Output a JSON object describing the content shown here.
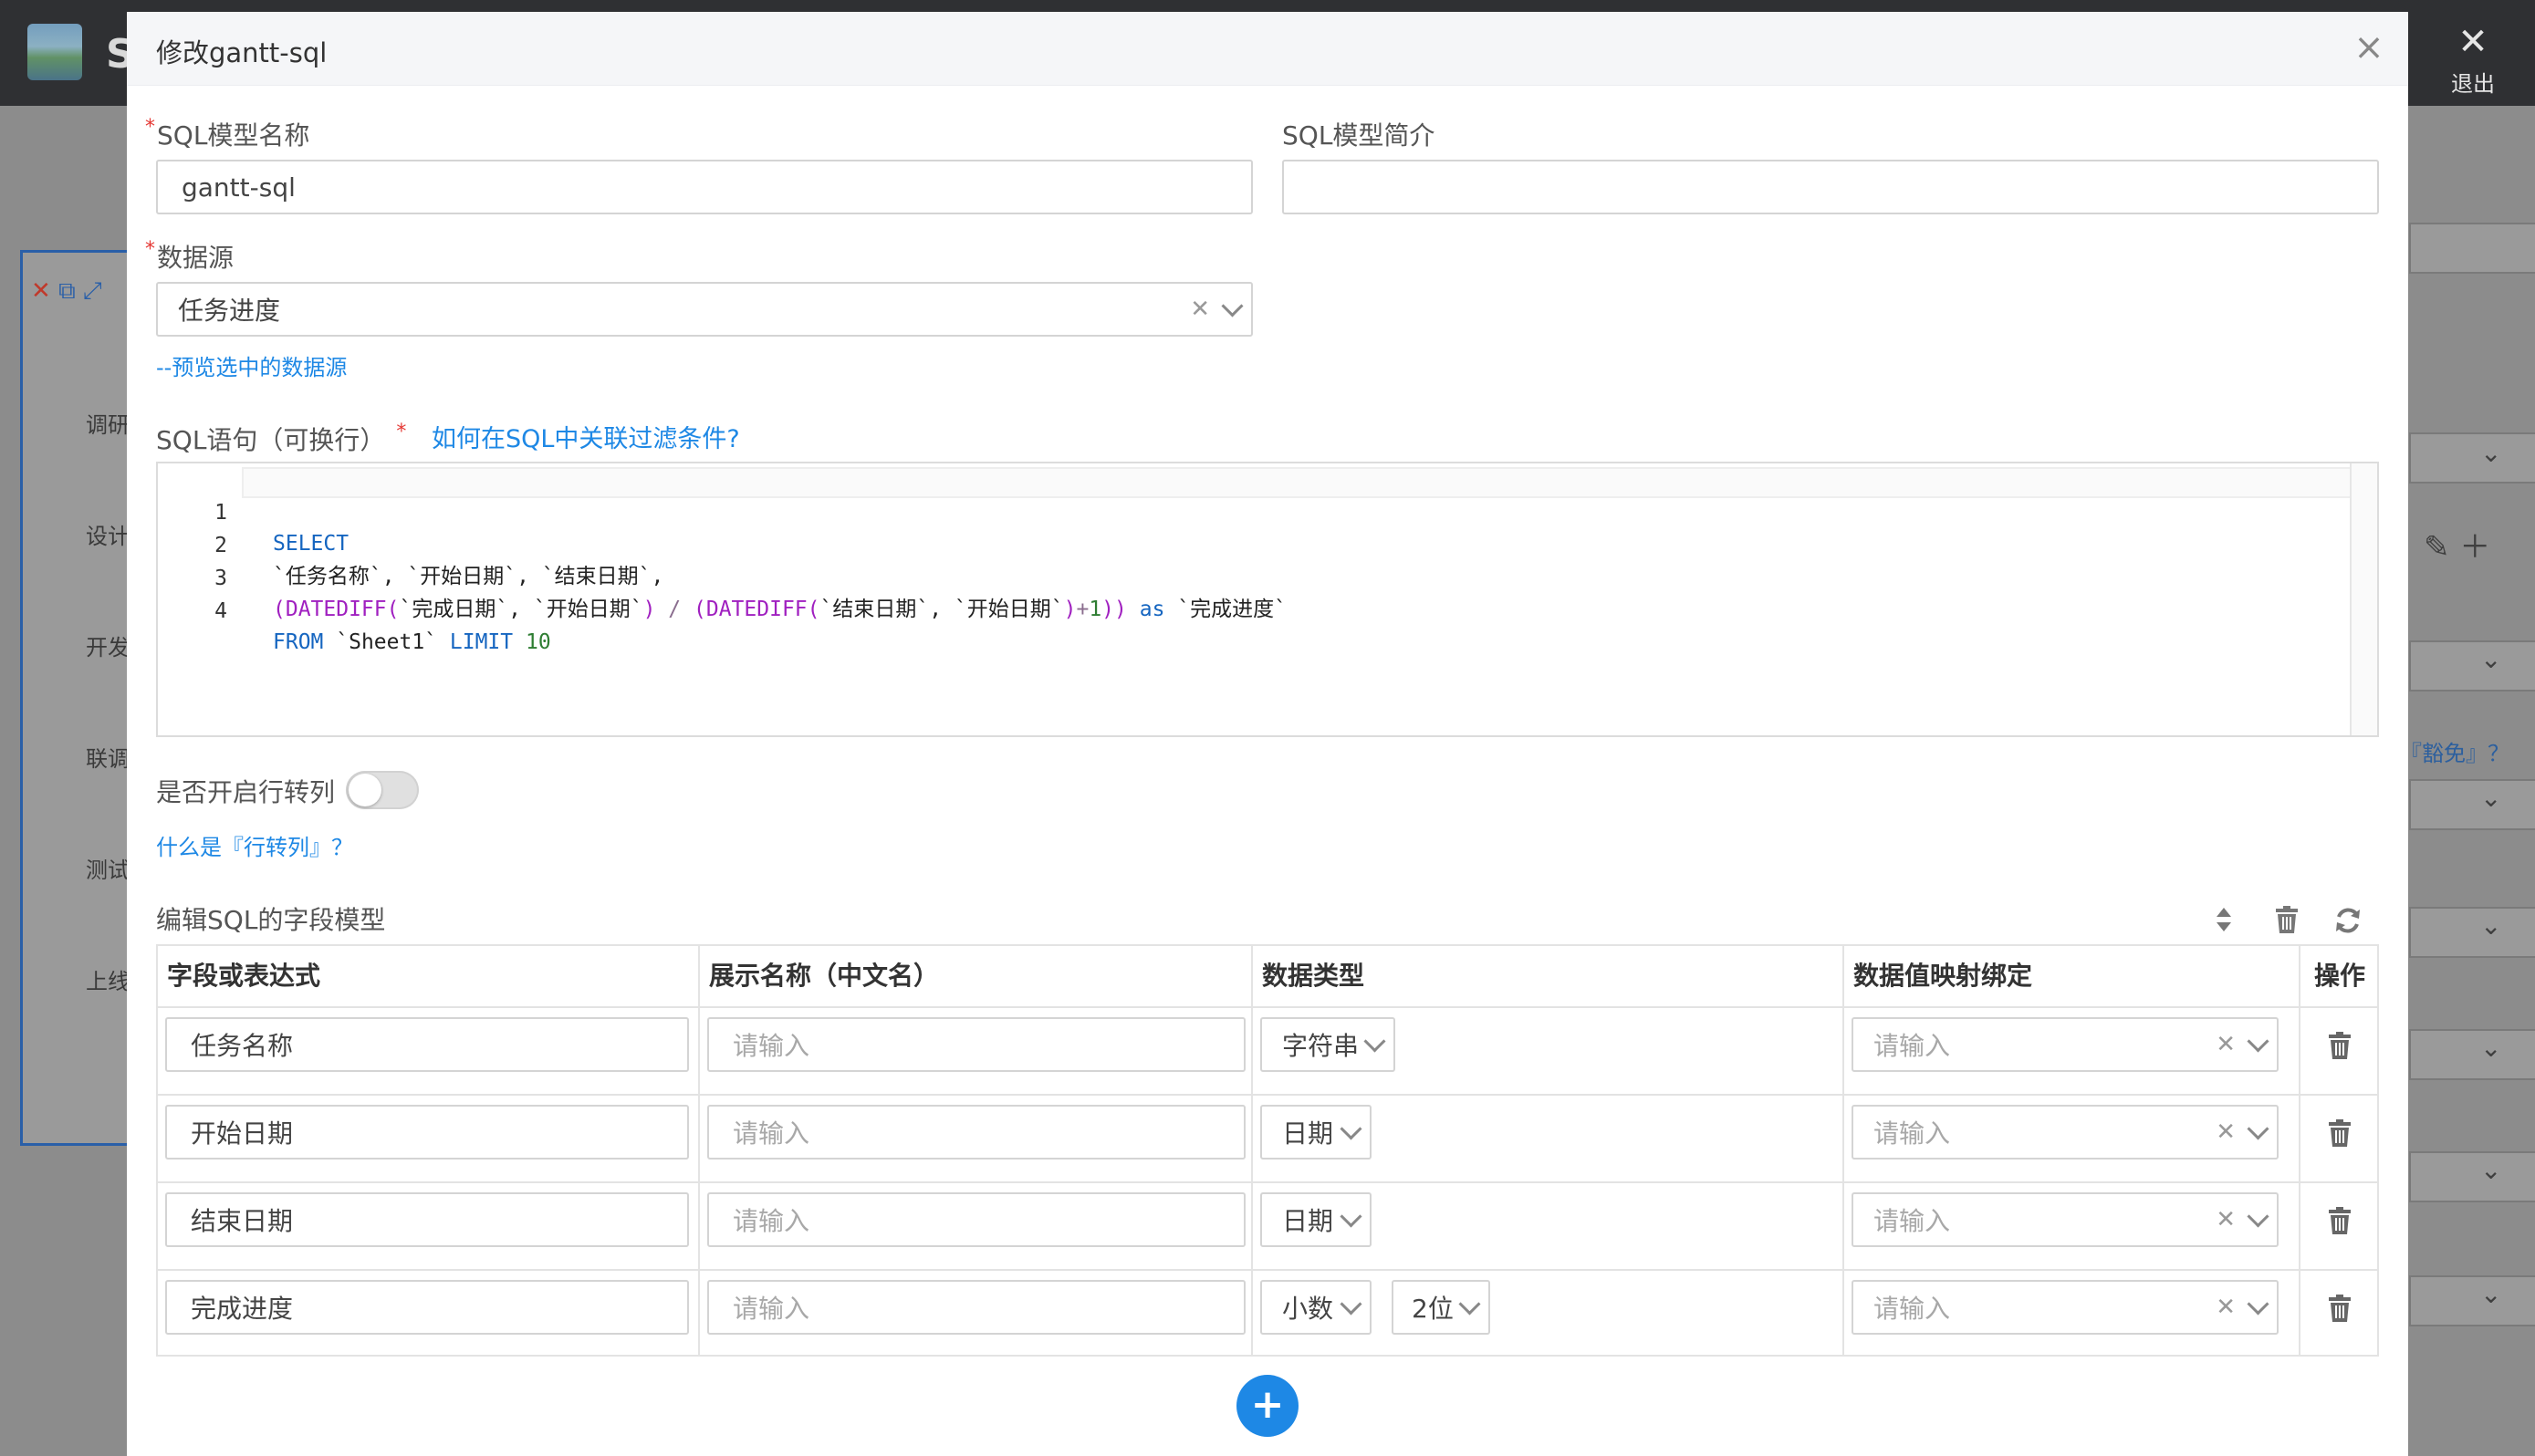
{
  "background": {
    "app_initial": "S",
    "exit_label": "退出",
    "side_items": [
      "调研",
      "设计",
      "开发",
      "联调",
      "测试",
      "上线"
    ],
    "right_link_text": "『豁免』？"
  },
  "modal": {
    "title": "修改gantt-sql",
    "close_icon": "×"
  },
  "form": {
    "name_label": "SQL模型名称",
    "name_value": "gantt-sql",
    "desc_label": "SQL模型简介",
    "desc_value": "",
    "datasource_label": "数据源",
    "datasource_value": "任务进度",
    "preview_link": "--预览选中的数据源",
    "sql_label": "SQL语句（可换行）",
    "sql_help_link": "如何在SQL中关联过滤条件?",
    "pivot_label": "是否开启行转列",
    "pivot_enabled": false,
    "pivot_help_link": "什么是『行转列』？",
    "required_mark": "*"
  },
  "sql_code": {
    "line_numbers": [
      "1",
      "2",
      "3",
      "4"
    ]
  },
  "field_model": {
    "section_title": "编辑SQL的字段模型",
    "columns": [
      "字段或表达式",
      "展示名称（中文名）",
      "数据类型",
      "数据值映射绑定",
      "操作"
    ],
    "input_placeholder": "请输入",
    "rows": [
      {
        "field": "任务名称",
        "display": "",
        "type": "字符串",
        "precision": "",
        "mapping": ""
      },
      {
        "field": "开始日期",
        "display": "",
        "type": "日期",
        "precision": "",
        "mapping": ""
      },
      {
        "field": "结束日期",
        "display": "",
        "type": "日期",
        "precision": "",
        "mapping": ""
      },
      {
        "field": "完成进度",
        "display": "",
        "type": "小数",
        "precision": "2位",
        "mapping": ""
      }
    ],
    "add_label": "+"
  },
  "colors": {
    "accent": "#1e88e5",
    "keyword": "#1565c0",
    "function": "#a020c0",
    "required": "#e53935"
  }
}
